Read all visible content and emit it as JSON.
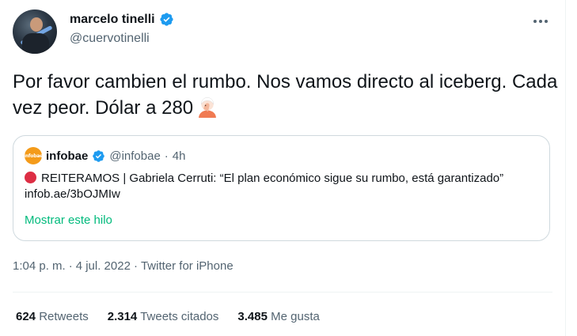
{
  "author": {
    "display_name": "marcelo tinelli",
    "handle": "@cuervotinelli"
  },
  "tweet": {
    "text": "Por favor cambien el rumbo. Nos vamos directo al iceberg. Cada vez peor. Dólar a 280",
    "emoji": "face-palm-emoji"
  },
  "quoted": {
    "logo_text": "infobae",
    "display_name": "infobae",
    "handle": "@infobae",
    "separator": "·",
    "time": "4h",
    "text": "REITERAMOS | Gabriela Cerruti: “El plan económico sigue su rumbo, está garantizado” infob.ae/3bOJMIw",
    "show_thread": "Mostrar este hilo"
  },
  "meta": {
    "time": "1:04 p. m.",
    "sep1": "·",
    "date": "4 jul. 2022",
    "sep2": "·",
    "source": "Twitter for iPhone"
  },
  "stats": {
    "retweets_count": "624",
    "retweets_label": "Retweets",
    "quotes_count": "2.314",
    "quotes_label": "Tweets citados",
    "likes_count": "3.485",
    "likes_label": "Me gusta"
  },
  "colors": {
    "verified": "#1d9bf0",
    "link": "#00ba7c",
    "secondary_text": "#536471",
    "infobae_orange": "#f49b1a"
  }
}
